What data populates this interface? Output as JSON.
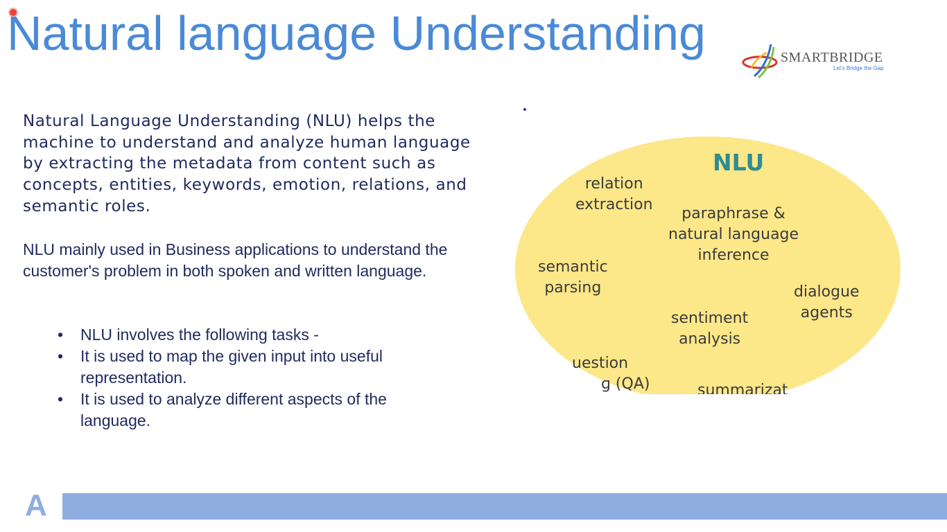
{
  "slide": {
    "title": "Natural language Understanding",
    "paragraph1": "Natural Language Understanding (NLU) helps the machine to understand and analyze human language by extracting the metadata from content such as concepts, entities, keywords, emotion, relations, and semantic roles.",
    "paragraph2": "NLU mainly used in Business applications to understand the customer's problem in both spoken and written language.",
    "bullets": [
      "NLU involves the following tasks -",
      "It is used to map the given input into useful representation.",
      "It is used to analyze different aspects of the language."
    ],
    "bullet_char": "•"
  },
  "logo": {
    "name": "SMARTBRIDGE",
    "tagline": "Let's Bridge the Gap"
  },
  "diagram": {
    "title": "NLU",
    "terms": {
      "relation_extraction": "relation\nextraction",
      "paraphrase": "paraphrase &\nnatural language\ninference",
      "semantic_parsing": "semantic\nparsing",
      "dialogue_agents": "dialogue\nagents",
      "sentiment_analysis": "sentiment\nanalysis",
      "question_answering": "uestion\n      ɡ (QA)",
      "summarization": "summarizat"
    },
    "fill_color": "#fce789",
    "title_color": "#2f8c94"
  },
  "footer": {
    "logo_text": "A",
    "bar_color": "#8eaedf"
  },
  "colors": {
    "title": "#4a8ad6",
    "body_text": "#1e2a5e"
  }
}
